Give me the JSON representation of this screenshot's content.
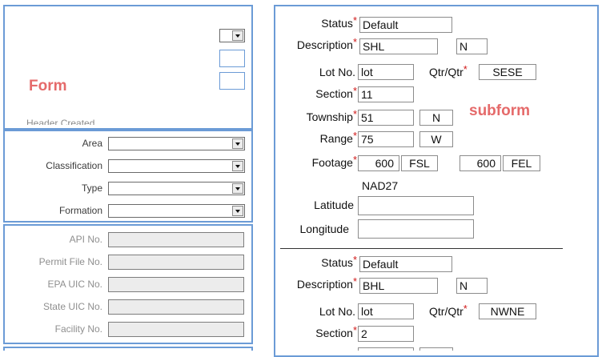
{
  "form": {
    "title": "Form",
    "header_created_label": "Header Created",
    "classification_fields": [
      {
        "label": "Area",
        "value": ""
      },
      {
        "label": "Classification",
        "value": ""
      },
      {
        "label": "Type",
        "value": ""
      },
      {
        "label": "Formation",
        "value": ""
      }
    ],
    "id_fields": [
      {
        "label": "API No.",
        "value": ""
      },
      {
        "label": "Permit File No.",
        "value": ""
      },
      {
        "label": "EPA UIC No.",
        "value": ""
      },
      {
        "label": "State UIC No.",
        "value": ""
      },
      {
        "label": "Facility No.",
        "value": ""
      }
    ]
  },
  "subform": {
    "title": "subform",
    "required_mark": "*",
    "labels": {
      "status": "Status",
      "description": "Description",
      "lot_no": "Lot No.",
      "qtr_qtr": "Qtr/Qtr",
      "section": "Section",
      "township": "Township",
      "range": "Range",
      "footage": "Footage",
      "latitude": "Latitude",
      "longitude": "Longitude"
    },
    "datum": "NAD27",
    "records": [
      {
        "status": "Default",
        "description": "SHL",
        "description_flag": "N",
        "lot": "lot",
        "qtr_qtr": "SESE",
        "section": "11",
        "township": "51",
        "township_dir": "N",
        "range": "75",
        "range_dir": "W",
        "footage_ns": "600",
        "footage_ns_ref": "FSL",
        "footage_ew": "600",
        "footage_ew_ref": "FEL",
        "latitude": "",
        "longitude": ""
      },
      {
        "status": "Default",
        "description": "BHL",
        "description_flag": "N",
        "lot": "lot",
        "qtr_qtr": "NWNE",
        "section": "2"
      }
    ]
  }
}
